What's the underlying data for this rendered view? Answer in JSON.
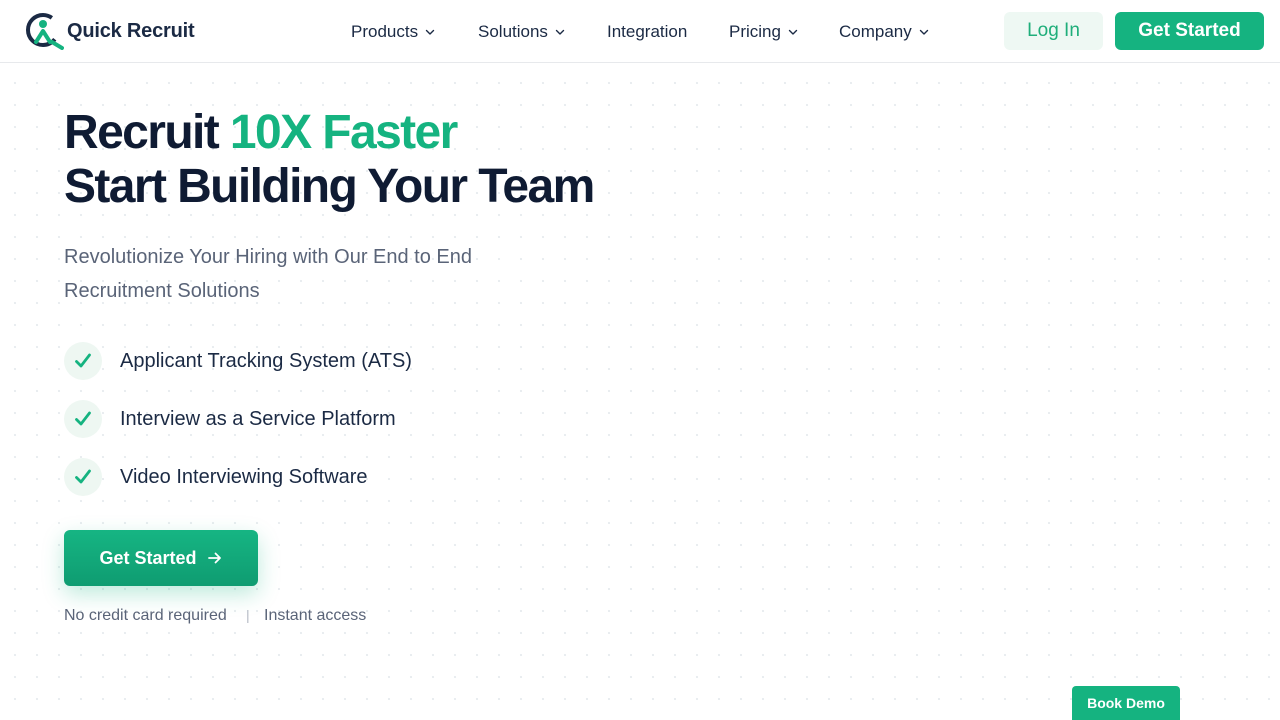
{
  "brand": {
    "name": "Quick Recruit",
    "colors": {
      "primary": "#15b380",
      "dark": "#1b2a44",
      "muted": "#5a6478"
    },
    "logo_icon": "quick-recruit-logo-icon"
  },
  "nav": {
    "items": [
      {
        "label": "Products",
        "has_dropdown": true
      },
      {
        "label": "Solutions",
        "has_dropdown": true
      },
      {
        "label": "Integration",
        "has_dropdown": false
      },
      {
        "label": "Pricing",
        "has_dropdown": true
      },
      {
        "label": "Company",
        "has_dropdown": true
      }
    ],
    "dropdown_icon": "chevron-down-icon",
    "login_label": "Log In",
    "get_started_label": "Get Started"
  },
  "hero": {
    "title_prefix": "Recruit ",
    "title_accent": "10X Faster",
    "title_line2": "Start Building Your Team",
    "subtitle": "Revolutionize Your Hiring with Our End to End Recruitment Solutions",
    "features": [
      "Applicant Tracking System (ATS)",
      "Interview as a Service Platform",
      "Video Interviewing Software"
    ],
    "feature_icon": "checkmark-icon",
    "cta_label": "Get Started",
    "cta_icon": "arrow-right-icon",
    "notes": [
      "No credit card required",
      "Instant access"
    ],
    "note_separator": "|"
  },
  "book_demo_label": "Book Demo"
}
